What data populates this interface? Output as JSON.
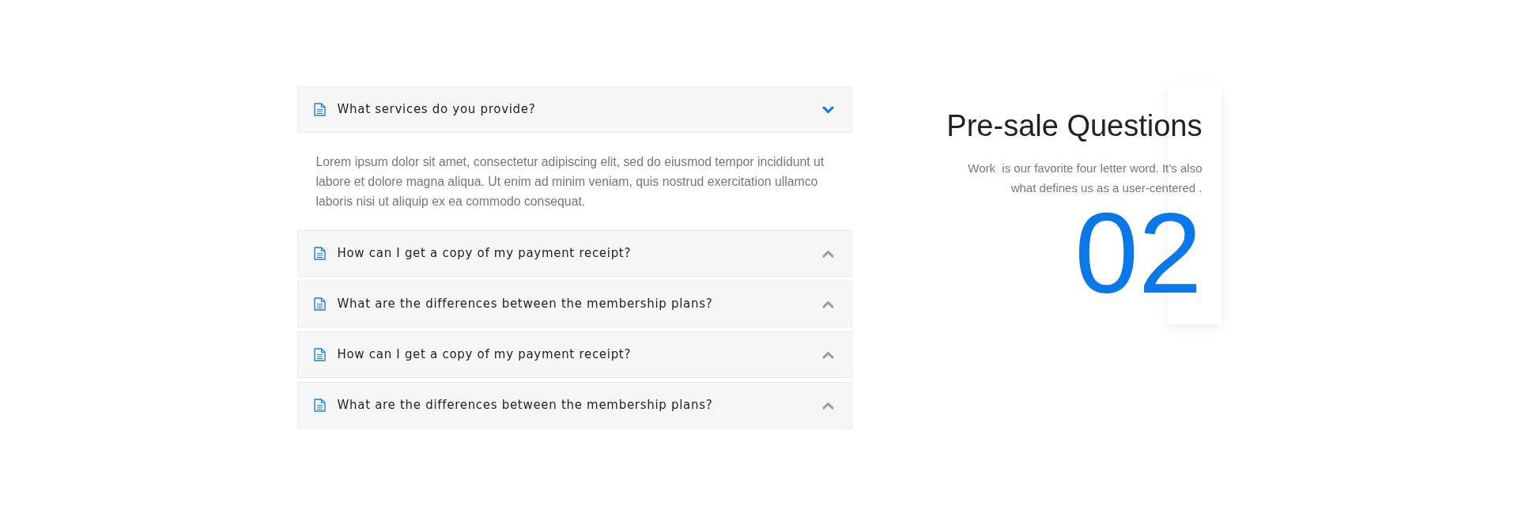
{
  "accordion": [
    {
      "question": "What services do you provide?",
      "expanded": true,
      "answer": "Lorem ipsum dolor sit amet, consectetur adipiscing elit, sed do eiusmod tempor incididunt ut labore et dolore magna aliqua. Ut enim ad minim veniam, quis nostrud exercitation ullamco laboris nisi ut aliquip ex ea commodo consequat."
    },
    {
      "question": "How can I get a copy of my payment receipt?",
      "expanded": false
    },
    {
      "question": "What are the differences between the membership plans?",
      "expanded": false
    },
    {
      "question": "How can I get a copy of my payment receipt?",
      "expanded": false
    },
    {
      "question": "What are the differences between the membership plans?",
      "expanded": false
    }
  ],
  "intro": {
    "title": "Pre-sale Questions",
    "text": "Work  is our favorite four letter word. It’s also what defines us as a user-centered .",
    "number": "02"
  }
}
